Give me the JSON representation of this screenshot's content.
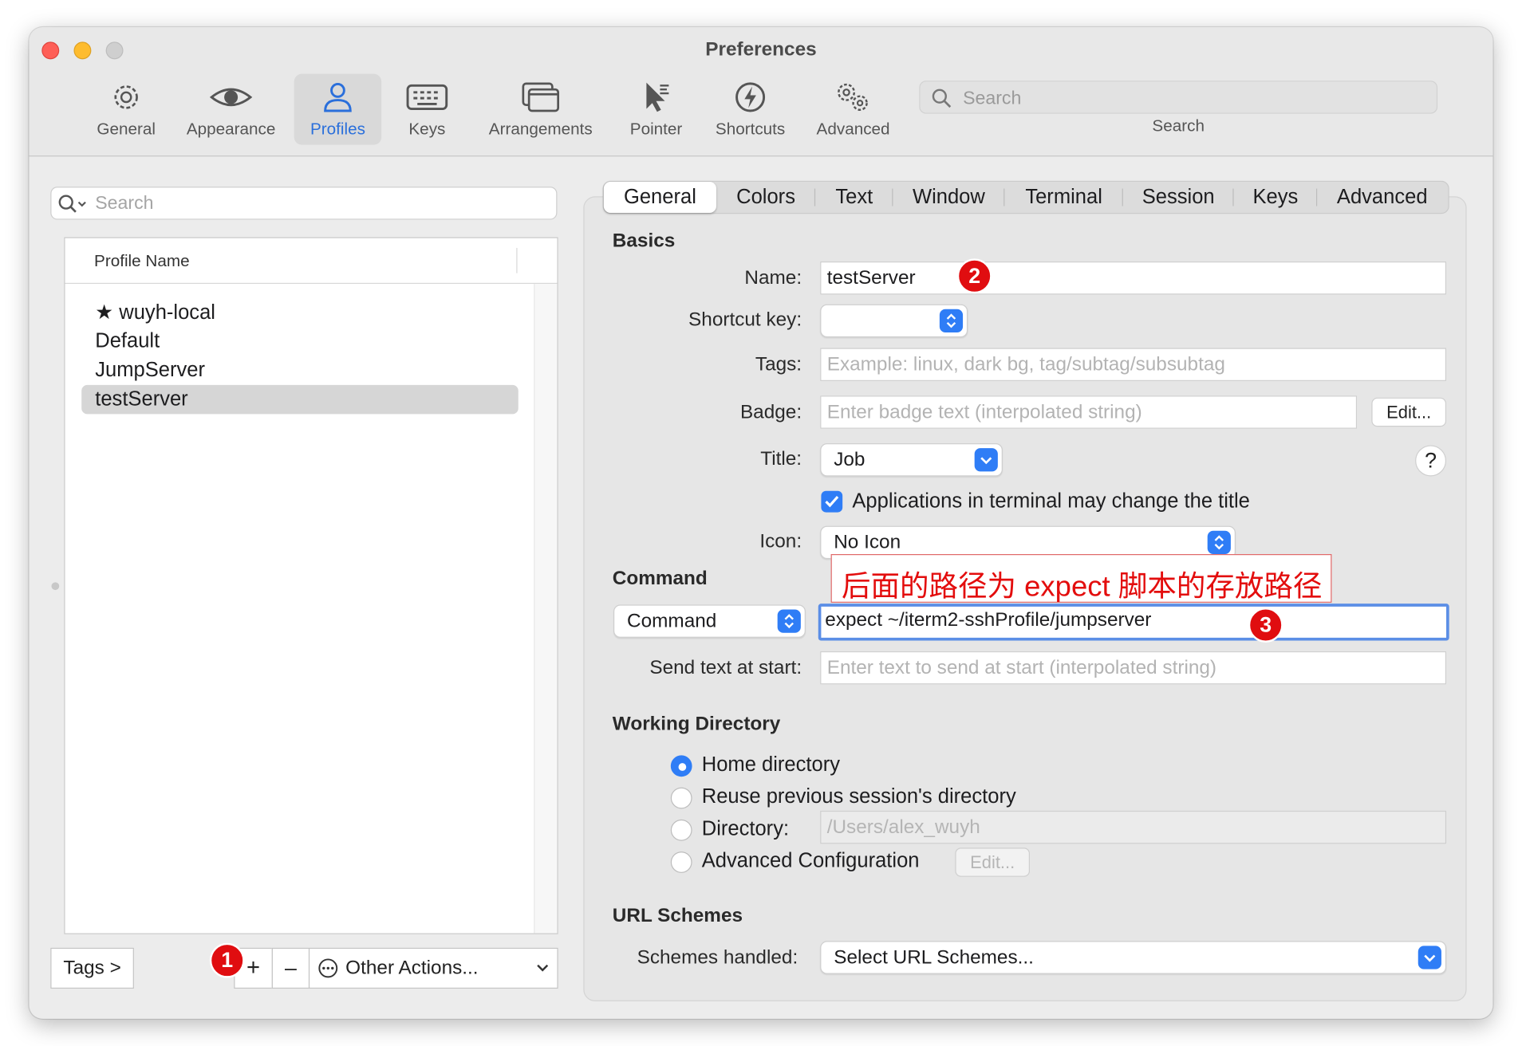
{
  "window": {
    "title": "Preferences"
  },
  "toolbar": {
    "items": [
      {
        "label": "General",
        "icon": "gear-icon"
      },
      {
        "label": "Appearance",
        "icon": "eye-icon"
      },
      {
        "label": "Profiles",
        "icon": "person-icon"
      },
      {
        "label": "Keys",
        "icon": "keyboard-icon"
      },
      {
        "label": "Arrangements",
        "icon": "windows-icon"
      },
      {
        "label": "Pointer",
        "icon": "cursor-icon"
      },
      {
        "label": "Shortcuts",
        "icon": "lightning-icon"
      },
      {
        "label": "Advanced",
        "icon": "gears-icon"
      }
    ],
    "search_placeholder": "Search",
    "search_label": "Search",
    "active_index": 2
  },
  "profiles": {
    "search_placeholder": "Search",
    "column_header": "Profile Name",
    "items": [
      "★ wuyh-local",
      "Default",
      "JumpServer",
      "testServer"
    ],
    "selected": "testServer",
    "tags_button": "Tags >",
    "add_button": "+",
    "remove_button": "–",
    "other_actions": "Other Actions..."
  },
  "tabs": [
    "General",
    "Colors",
    "Text",
    "Window",
    "Terminal",
    "Session",
    "Keys",
    "Advanced"
  ],
  "general": {
    "basics_heading": "Basics",
    "name_label": "Name:",
    "name_value": "testServer",
    "shortcut_label": "Shortcut key:",
    "tags_label": "Tags:",
    "tags_placeholder": "Example: linux, dark bg, tag/subtag/subsubtag",
    "badge_label": "Badge:",
    "badge_placeholder": "Enter badge text (interpolated string)",
    "badge_edit": "Edit...",
    "title_label": "Title:",
    "title_value": "Job",
    "help": "?",
    "apps_change_title": "Applications in terminal may change the title",
    "icon_label": "Icon:",
    "icon_value": "No Icon",
    "command_heading": "Command",
    "command_type": "Command",
    "command_value": "expect ~/iterm2-sshProfile/jumpserver",
    "send_text_label": "Send text at start:",
    "send_text_placeholder": "Enter text to send at start (interpolated string)",
    "workdir_heading": "Working Directory",
    "workdir_options": [
      "Home directory",
      "Reuse previous session's directory",
      "Directory:",
      "Advanced Configuration"
    ],
    "directory_value": "/Users/alex_wuyh",
    "advanced_edit": "Edit...",
    "url_heading": "URL Schemes",
    "schemes_label": "Schemes handled:",
    "schemes_value": "Select URL Schemes..."
  },
  "annotations": {
    "note": "后面的路径为 expect 脚本的存放路径",
    "badges": [
      "1",
      "2",
      "3"
    ]
  }
}
